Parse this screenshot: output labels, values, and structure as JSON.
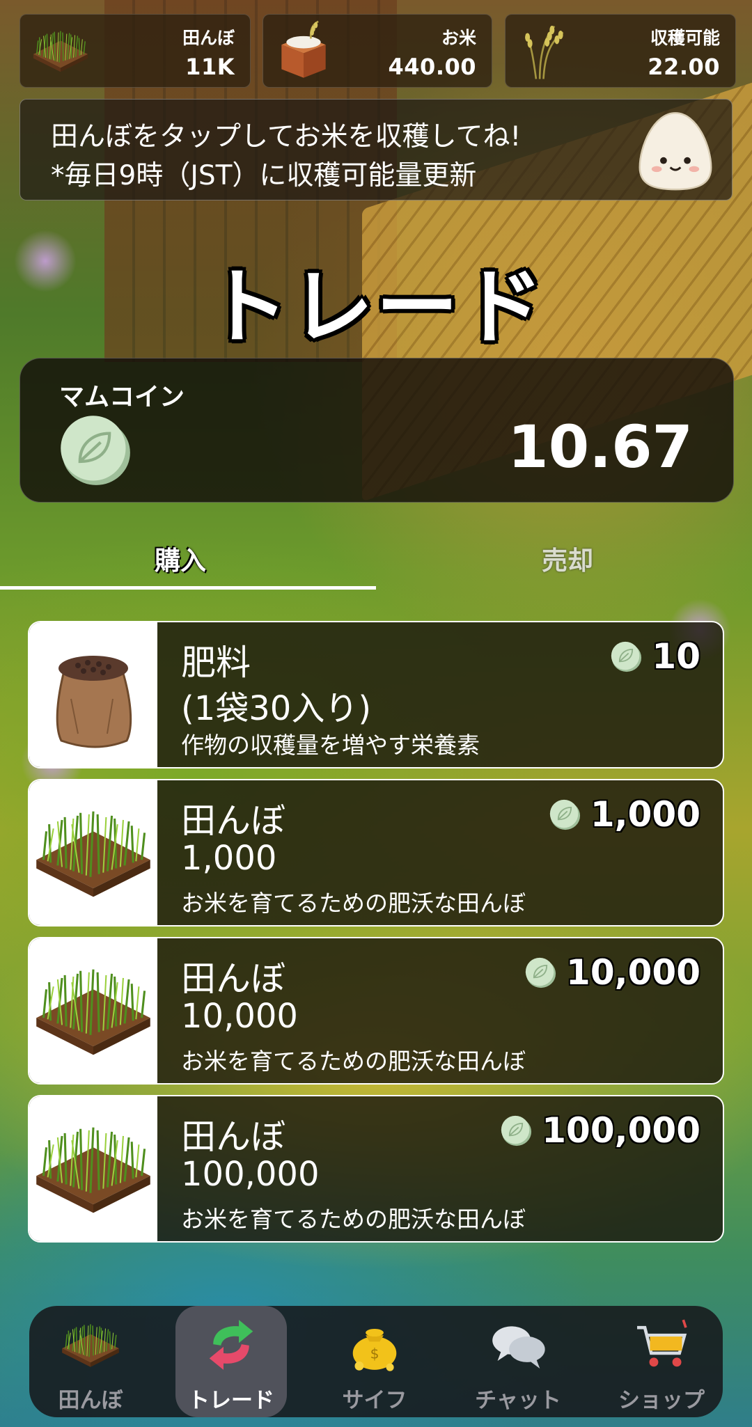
{
  "stats": [
    {
      "label": "田んぼ",
      "value": "11K",
      "icon": "rice-field-icon"
    },
    {
      "label": "お米",
      "value": "440.00",
      "icon": "rice-box-icon"
    },
    {
      "label": "収穫可能",
      "value": "22.00",
      "icon": "rice-stalk-icon"
    }
  ],
  "notice": {
    "line1": "田んぼをタップしてお米を収穫してね!",
    "line2": "*毎日9時（JST）に収穫可能量更新"
  },
  "page_title": "トレード",
  "coin": {
    "name": "マムコイン",
    "balance": "10.67"
  },
  "tabs": {
    "buy": "購入",
    "sell": "売却",
    "active": "buy"
  },
  "items": [
    {
      "name": "肥料",
      "quantity": "(1袋30入り)",
      "description": "作物の収穫量を増やす栄養素",
      "price": "10",
      "icon": "fertilizer-bag-icon"
    },
    {
      "name": "田んぼ",
      "quantity": "1,000",
      "description": "お米を育てるための肥沃な田んぼ",
      "price": "1,000",
      "icon": "rice-field-icon"
    },
    {
      "name": "田んぼ",
      "quantity": "10,000",
      "description": "お米を育てるための肥沃な田んぼ",
      "price": "10,000",
      "icon": "rice-field-icon"
    },
    {
      "name": "田んぼ",
      "quantity": "100,000",
      "description": "お米を育てるための肥沃な田んぼ",
      "price": "100,000",
      "icon": "rice-field-icon"
    }
  ],
  "nav": [
    {
      "label": "田んぼ",
      "icon": "rice-field-icon",
      "active": false
    },
    {
      "label": "トレード",
      "icon": "trade-arrows-icon",
      "active": true
    },
    {
      "label": "サイフ",
      "icon": "money-bag-icon",
      "active": false
    },
    {
      "label": "チャット",
      "icon": "chat-bubbles-icon",
      "active": false
    },
    {
      "label": "ショップ",
      "icon": "shopping-cart-icon",
      "active": false
    }
  ],
  "colors": {
    "coin_green": "#cfe6c9",
    "card_background": "#1c190f",
    "accent_white": "#ffffff"
  }
}
